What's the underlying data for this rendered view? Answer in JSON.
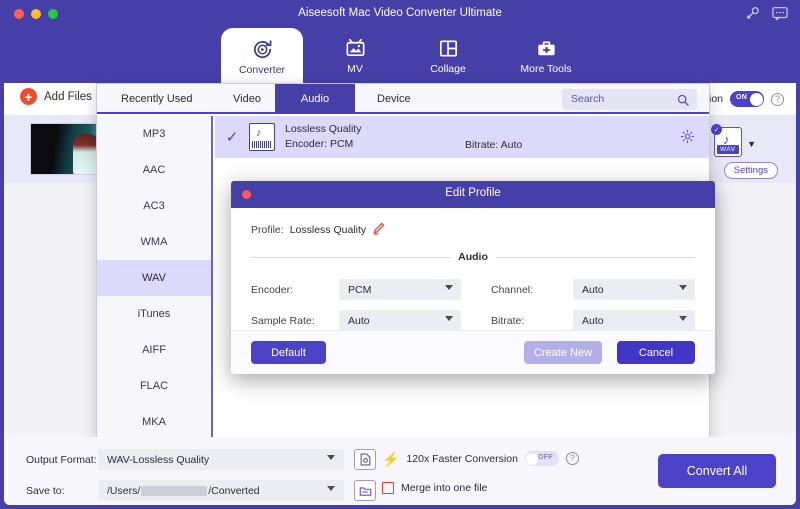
{
  "window": {
    "title": "Aiseesoft Mac Video Converter Ultimate",
    "key_icon": "key-icon",
    "message_icon": "message-icon"
  },
  "mainnav": {
    "tabs": [
      {
        "label": "Converter",
        "icon": "converter-icon",
        "active": true
      },
      {
        "label": "MV",
        "icon": "mv-icon",
        "active": false
      },
      {
        "label": "Collage",
        "icon": "collage-icon",
        "active": false
      },
      {
        "label": "More Tools",
        "icon": "more-tools-icon",
        "active": false
      }
    ]
  },
  "toolbar": {
    "add_files_label": "Add Files",
    "plus_icon": "plus-icon",
    "fast_conversion_suffix": "tion",
    "toggle_state": "ON",
    "help_icon": "question-mark-icon"
  },
  "filelist": {
    "format_badge_tag": "WAV",
    "settings_label": "Settings",
    "check_icon": "check-icon",
    "caret_icon": "caret-down-icon"
  },
  "dropdown": {
    "tabs": [
      {
        "label": "Recently Used",
        "active": false
      },
      {
        "label": "Video",
        "active": false
      },
      {
        "label": "Audio",
        "active": true
      },
      {
        "label": "Device",
        "active": false
      }
    ],
    "search": {
      "placeholder": "Search",
      "icon": "search-icon"
    },
    "formats": [
      {
        "label": "MP3",
        "selected": false
      },
      {
        "label": "AAC",
        "selected": false
      },
      {
        "label": "AC3",
        "selected": false
      },
      {
        "label": "WMA",
        "selected": false
      },
      {
        "label": "WAV",
        "selected": true
      },
      {
        "label": "iTunes",
        "selected": false
      },
      {
        "label": "AIFF",
        "selected": false
      },
      {
        "label": "FLAC",
        "selected": false
      },
      {
        "label": "MKA",
        "selected": false
      }
    ],
    "profile": {
      "name": "Lossless Quality",
      "encoder": "Encoder: PCM",
      "bitrate": "Bitrate: Auto",
      "gear_icon": "gear-icon",
      "check_icon": "check-icon"
    }
  },
  "dialog": {
    "title": "Edit Profile",
    "close_icon": "close-icon",
    "profile_label": "Profile:",
    "profile_value": "Lossless Quality",
    "edit_icon": "pencil-icon",
    "section_title": "Audio",
    "fields": [
      {
        "label": "Encoder:",
        "value": "PCM"
      },
      {
        "label": "Channel:",
        "value": "Auto"
      },
      {
        "label": "Sample Rate:",
        "value": "Auto"
      },
      {
        "label": "Bitrate:",
        "value": "Auto"
      }
    ],
    "buttons": {
      "default": "Default",
      "create_new": "Create New",
      "cancel": "Cancel"
    }
  },
  "bottom": {
    "output_format_label": "Output Format:",
    "output_format_value": "WAV-Lossless Quality",
    "save_to_label": "Save to:",
    "save_to_prefix": "/Users/",
    "save_to_suffix": "/Converted",
    "fast_conversion_label": "120x Faster Conversion",
    "fast_toggle_state": "OFF",
    "merge_label": "Merge into one file",
    "convert_all_label": "Convert All",
    "help_icon": "question-mark-icon",
    "bolt_icon": "bolt-icon",
    "profile_settings_icon": "profile-settings-icon",
    "folder_icon": "folder-icon"
  },
  "colors": {
    "brand": "#473fa8",
    "accent": "#4b42c8",
    "highlight": "#ddd9fa",
    "danger": "#f03a2a"
  }
}
